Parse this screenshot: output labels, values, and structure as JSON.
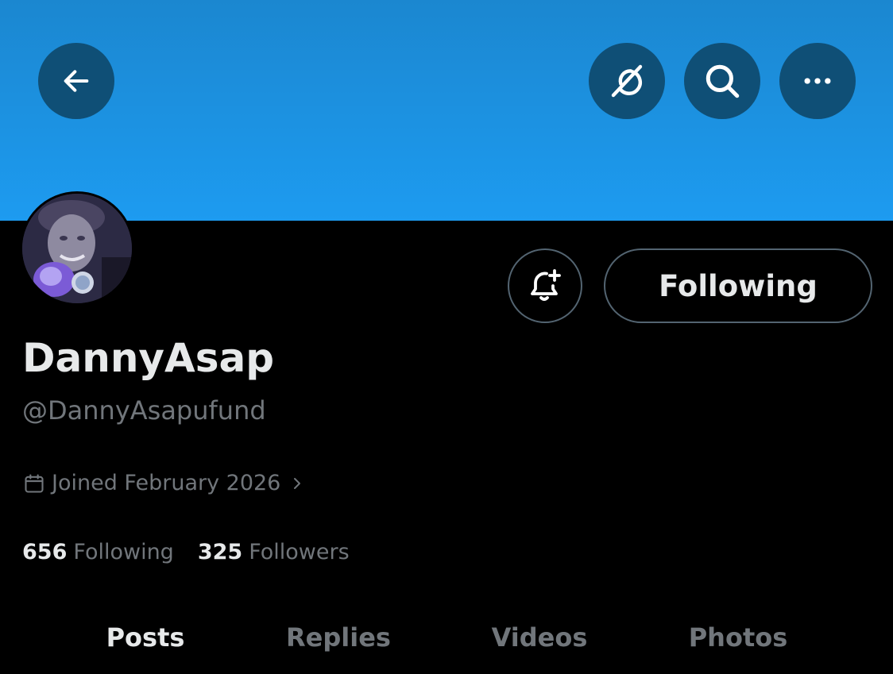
{
  "header": {
    "back_icon": "arrow-left-icon",
    "grok_icon": "grok-icon",
    "search_icon": "search-icon",
    "more_icon": "more-horizontal-icon",
    "banner_color": "#1d9bf0",
    "button_color": "#0f4f76"
  },
  "profile": {
    "display_name": "DannyAsap",
    "handle": "@DannyAsapufund",
    "joined": "Joined February 2026",
    "following_count": "656",
    "following_label": "Following",
    "followers_count": "325",
    "followers_label": "Followers"
  },
  "actions": {
    "notify_icon": "bell-plus-icon",
    "following_button": "Following"
  },
  "tabs": [
    {
      "label": "Posts",
      "active": true
    },
    {
      "label": "Replies",
      "active": false
    },
    {
      "label": "Videos",
      "active": false
    },
    {
      "label": "Photos",
      "active": false
    }
  ]
}
